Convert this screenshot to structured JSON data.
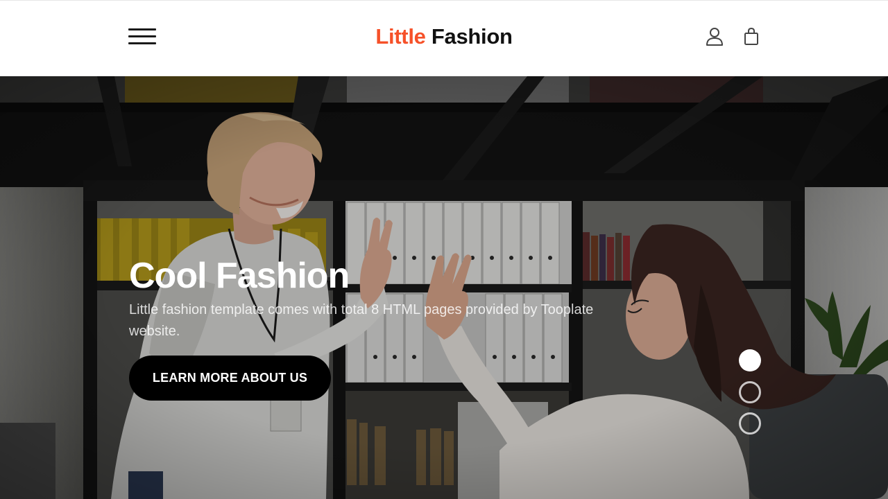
{
  "navbar": {
    "brand_accent": "Little",
    "brand_main": "Fashion",
    "icons": [
      "menu-icon",
      "user-icon",
      "shopping-bag-icon"
    ]
  },
  "hero": {
    "title": "Cool Fashion",
    "text": "Little fashion template comes with total 8 HTML pages provided by Tooplate website.",
    "button_label": "LEARN MORE ABOUT US",
    "slides": 3,
    "active_slide": 1
  },
  "colors": {
    "accent": "#f65129",
    "text_dark": "#111111",
    "button_bg": "#000000"
  }
}
